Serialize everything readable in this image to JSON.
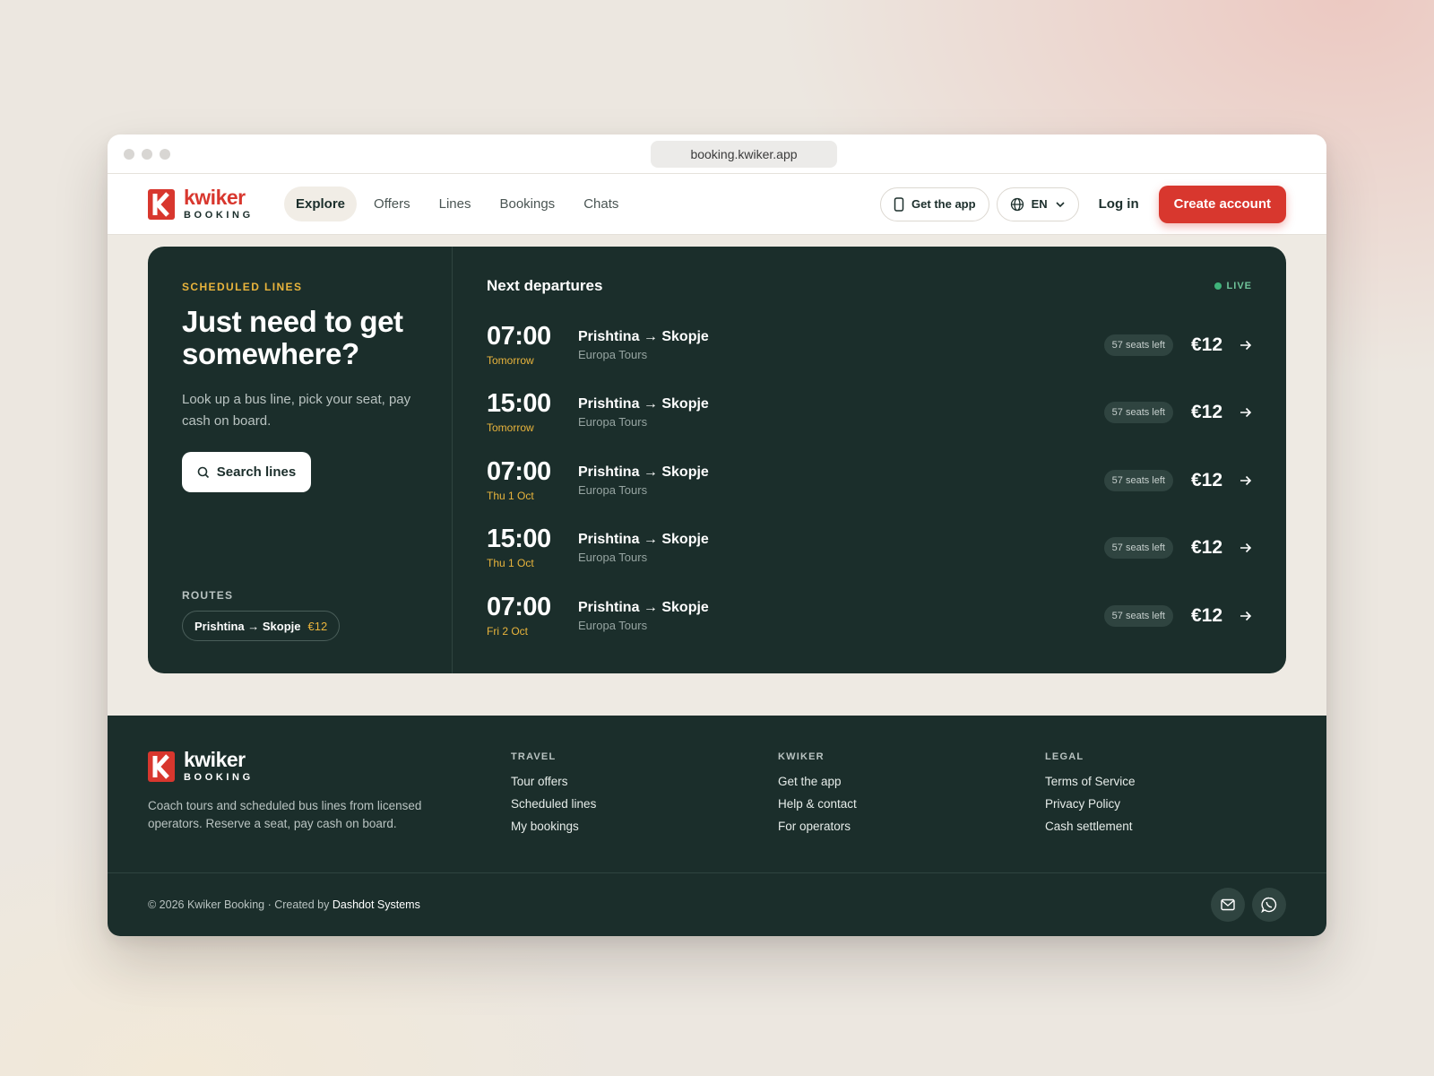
{
  "browser": {
    "url": "booking.kwiker.app"
  },
  "brand": {
    "name": "kwiker",
    "sub": "BOOKING",
    "accent": "#d8372e",
    "dark": "#1b2e2b",
    "gold": "#e9b43c"
  },
  "nav": {
    "links": [
      "Explore",
      "Offers",
      "Lines",
      "Bookings",
      "Chats"
    ],
    "active": "Explore",
    "get_app": "Get the app",
    "language": "EN",
    "login": "Log in",
    "create_account": "Create account"
  },
  "hero": {
    "eyebrow": "SCHEDULED LINES",
    "title": "Just need to get somewhere?",
    "description": "Look up a bus line, pick your seat, pay cash on board.",
    "search_label": "Search lines",
    "routes_label": "ROUTES",
    "route_chip": {
      "route": "Prishtina → Skopje",
      "price": "€12"
    }
  },
  "departures": {
    "title": "Next departures",
    "live_label": "LIVE",
    "rows": [
      {
        "time": "07:00",
        "day": "Tomorrow",
        "route": "Prishtina → Skopje",
        "operator": "Europa Tours",
        "seats": "57 seats left",
        "price": "€12"
      },
      {
        "time": "15:00",
        "day": "Tomorrow",
        "route": "Prishtina → Skopje",
        "operator": "Europa Tours",
        "seats": "57 seats left",
        "price": "€12"
      },
      {
        "time": "07:00",
        "day": "Thu 1 Oct",
        "route": "Prishtina → Skopje",
        "operator": "Europa Tours",
        "seats": "57 seats left",
        "price": "€12"
      },
      {
        "time": "15:00",
        "day": "Thu 1 Oct",
        "route": "Prishtina → Skopje",
        "operator": "Europa Tours",
        "seats": "57 seats left",
        "price": "€12"
      },
      {
        "time": "07:00",
        "day": "Fri 2 Oct",
        "route": "Prishtina → Skopje",
        "operator": "Europa Tours",
        "seats": "57 seats left",
        "price": "€12"
      }
    ]
  },
  "footer": {
    "description": "Coach tours and scheduled bus lines from licensed operators. Reserve a seat, pay cash on board.",
    "columns": [
      {
        "heading": "TRAVEL",
        "links": [
          "Tour offers",
          "Scheduled lines",
          "My bookings"
        ]
      },
      {
        "heading": "KWIKER",
        "links": [
          "Get the app",
          "Help & contact",
          "For operators"
        ]
      },
      {
        "heading": "LEGAL",
        "links": [
          "Terms of Service",
          "Privacy Policy",
          "Cash settlement"
        ]
      }
    ],
    "copyright": "© 2026 Kwiker Booking · Created by",
    "creator": "Dashdot Systems",
    "icons": [
      "mail-icon",
      "whatsapp-icon"
    ]
  }
}
